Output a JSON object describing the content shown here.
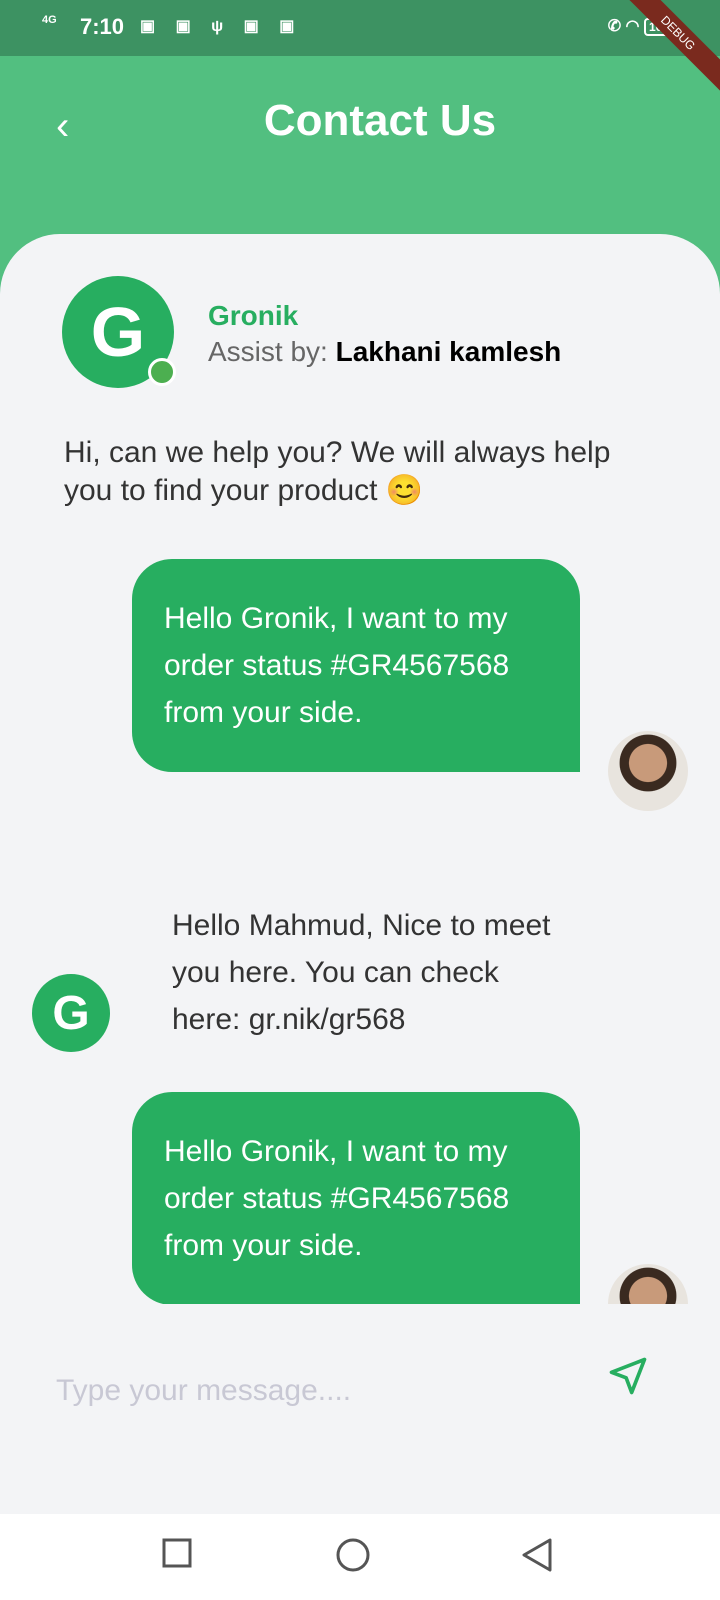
{
  "status": {
    "network": "4G",
    "time": "7:10",
    "battery": "100",
    "debug": "DEBUG"
  },
  "header": {
    "title": "Contact Us"
  },
  "agent": {
    "logo_letter": "G",
    "name": "Gronik",
    "assist_label": "Assist by:",
    "assistant": "Lakhani kamlesh"
  },
  "intro": "Hi, can we help you? We will always help you to find your product 😊",
  "messages": [
    {
      "from": "user",
      "text": "Hello Gronik, I want to my order status #GR4567568 from your side."
    },
    {
      "from": "agent",
      "text": "Hello Mahmud, Nice to meet you here. You can check here: gr.nik/gr568"
    },
    {
      "from": "user",
      "text": "Hello Gronik, I want to my order status #GR4567568 from your side."
    }
  ],
  "composer": {
    "placeholder": "Type your message...."
  },
  "colors": {
    "brand": "#27ae60"
  }
}
